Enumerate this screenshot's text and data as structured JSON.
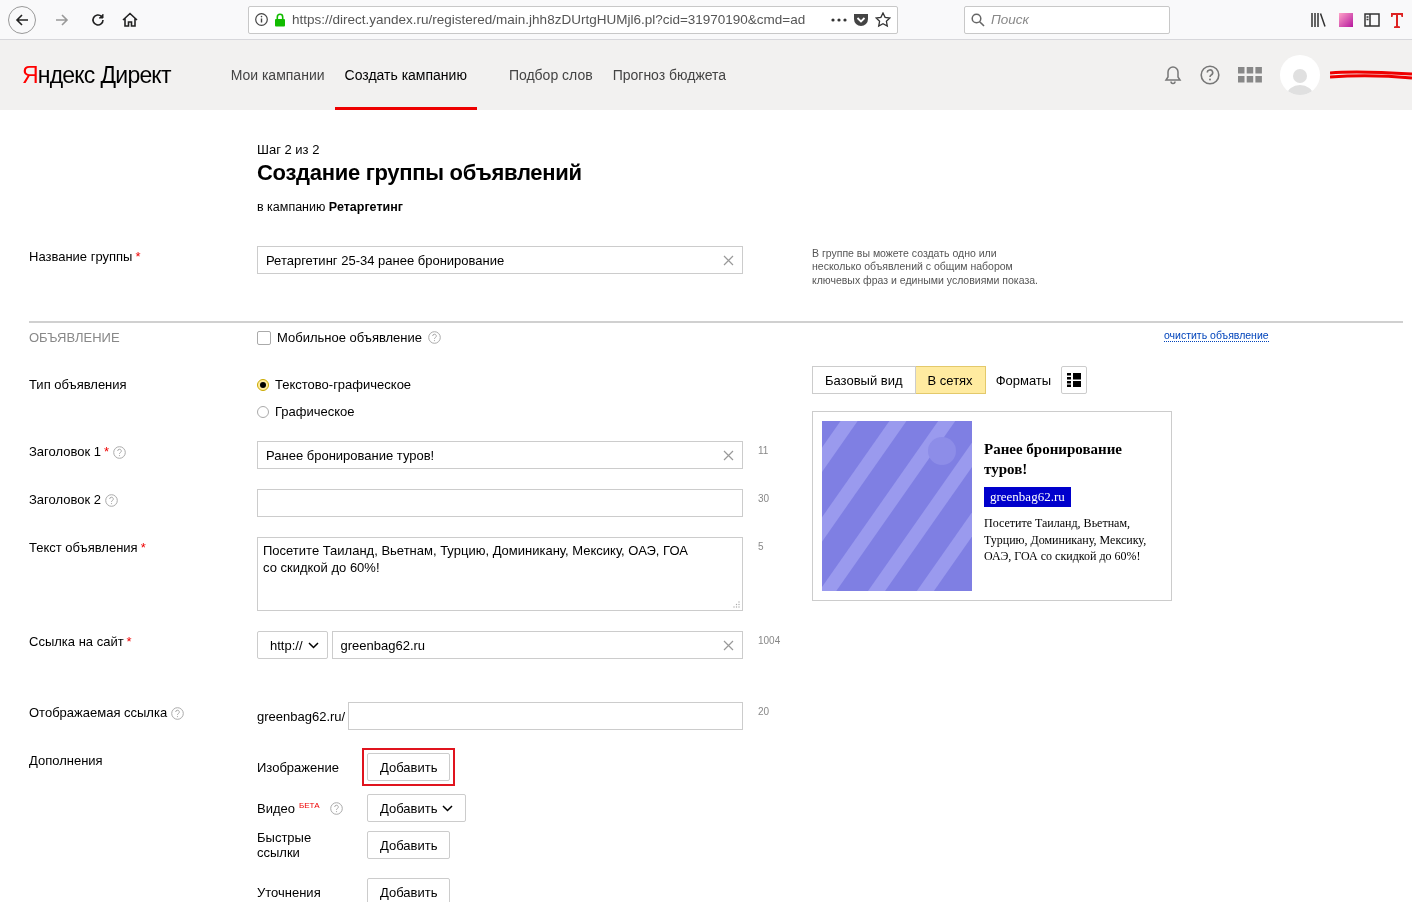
{
  "browser": {
    "url": "https://direct.yandex.ru/registered/main.jhh8zDUrtgHUMjl6.pl?cid=31970190&cmd=ad",
    "search_placeholder": "Поиск"
  },
  "header": {
    "brand": "Яндекс",
    "product": "Директ",
    "nav": [
      {
        "label": "Мои кампании",
        "selected": false
      },
      {
        "label": "Создать кампанию",
        "selected": true
      },
      {
        "label": "Подбор слов",
        "selected": false
      },
      {
        "label": "Прогноз бюджета",
        "selected": false
      }
    ],
    "user_redacted": true
  },
  "page": {
    "step": "Шаг 2 из 2",
    "title": "Создание группы объявлений",
    "campaign": "в кампанию **Ретаргетинг**"
  },
  "group_name": {
    "label": "Название группы",
    "asterisk": "*",
    "value": "Ретаргетинг 25-34 ранее бронирование",
    "hint": "В группе вы можете создать одно или несколько объявлений с общим набором ключевых фраз и едиными условиями показа."
  },
  "ad_section": {
    "label": "ОБЪЯВЛЕНИЕ",
    "mobile": {
      "label": "Мобильное объявление",
      "checked": false
    },
    "clear_link": "очистить объявление"
  },
  "ad_type": {
    "label": "Тип объявления",
    "options": [
      {
        "label": "Текстово-графическое",
        "selected": true
      },
      {
        "label": "Графическое",
        "selected": false
      }
    ]
  },
  "fields": [
    {
      "kind": "input",
      "label": "Заголовок 1",
      "asterisk": "*",
      "help": true,
      "value": "Ранее бронирование туров!",
      "clearable": true,
      "counter": "11"
    },
    {
      "kind": "input",
      "label": "Заголовок 2",
      "help": true,
      "clearable": false,
      "counter": "30"
    },
    {
      "kind": "textarea",
      "label": "Текст объявления",
      "asterisk": "*",
      "help": false,
      "value": "Посетите Таиланд, Вьетнам, Турцию, Доминикану, Мексику, ОАЭ, ГОА\nсо скидкой до 60%!",
      "counter": "5"
    },
    {
      "kind": "url",
      "label": "Ссылка на сайт",
      "asterisk": "*",
      "help": false,
      "protocol": "http://",
      "value": "greenbag62.ru",
      "clearable": true,
      "counter": "1004"
    },
    {
      "kind": "display",
      "label": "Отображаемая ссылка",
      "help": true,
      "prefix": "greenbag62.ru/",
      "counter": "20"
    }
  ],
  "extras": {
    "label": "Дополнения",
    "items": [
      {
        "label": "Изображение",
        "button": "Добавить",
        "highlighted": true,
        "dropdown": false,
        "help": false
      },
      {
        "label": "Видео",
        "badge": "БЕТА",
        "button": "Добавить",
        "highlighted": false,
        "dropdown": true,
        "help": true
      },
      {
        "label": "Быстрые ссылки",
        "button": "Добавить",
        "highlighted": false,
        "dropdown": false,
        "help": false
      },
      {
        "label": "Уточнения",
        "button": "Добавить",
        "highlighted": false,
        "dropdown": false,
        "help": false
      }
    ]
  },
  "preview": {
    "tabs": [
      {
        "label": "Базовый вид",
        "selected": false
      },
      {
        "label": "В сетях",
        "selected": true
      }
    ],
    "formats": "Форматы",
    "ad": {
      "title": "Ранее бронирование туров!",
      "domain": "greenbag62.ru",
      "text": "Посетите Таиланд, Вьетнам, Турцию, Доминикану, Мексику, ОАЭ, ГОА со скидкой до 60%!"
    }
  }
}
